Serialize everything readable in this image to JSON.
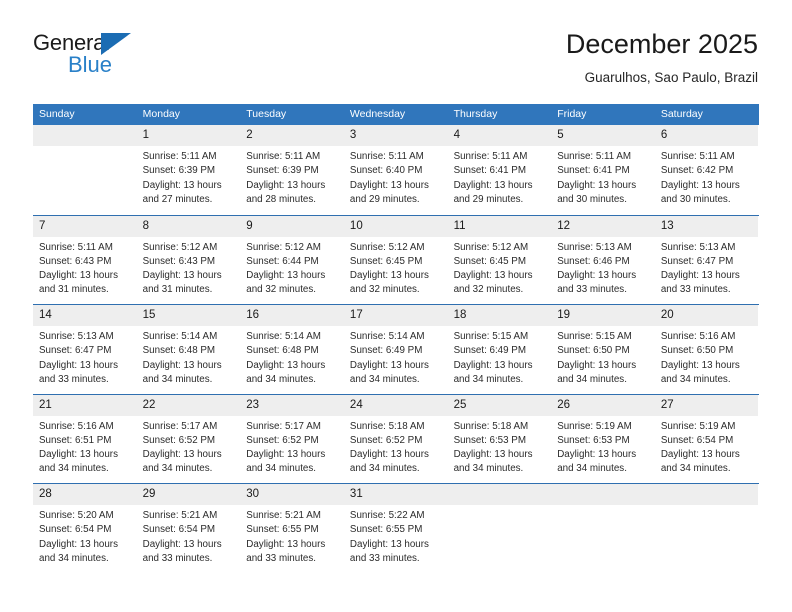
{
  "brand": {
    "name_part1": "General",
    "name_part2": "Blue",
    "color_dark": "#1b1b1b",
    "color_blue": "#2980c8",
    "triangle_color": "#1b6cb3"
  },
  "header": {
    "title": "December 2025",
    "subtitle": "Guarulhos, Sao Paulo, Brazil"
  },
  "theme": {
    "header_row_bg": "#3076bc",
    "header_row_text": "#ffffff",
    "week_separator": "#2f6fb0",
    "day_band_bg": "#eeeeee",
    "body_text": "#2b2b2b"
  },
  "calendar": {
    "weekdays": [
      "Sunday",
      "Monday",
      "Tuesday",
      "Wednesday",
      "Thursday",
      "Friday",
      "Saturday"
    ],
    "weeks": [
      [
        {
          "day": "",
          "lines": []
        },
        {
          "day": "1",
          "lines": [
            "Sunrise: 5:11 AM",
            "Sunset: 6:39 PM",
            "Daylight: 13 hours",
            "and 27 minutes."
          ]
        },
        {
          "day": "2",
          "lines": [
            "Sunrise: 5:11 AM",
            "Sunset: 6:39 PM",
            "Daylight: 13 hours",
            "and 28 minutes."
          ]
        },
        {
          "day": "3",
          "lines": [
            "Sunrise: 5:11 AM",
            "Sunset: 6:40 PM",
            "Daylight: 13 hours",
            "and 29 minutes."
          ]
        },
        {
          "day": "4",
          "lines": [
            "Sunrise: 5:11 AM",
            "Sunset: 6:41 PM",
            "Daylight: 13 hours",
            "and 29 minutes."
          ]
        },
        {
          "day": "5",
          "lines": [
            "Sunrise: 5:11 AM",
            "Sunset: 6:41 PM",
            "Daylight: 13 hours",
            "and 30 minutes."
          ]
        },
        {
          "day": "6",
          "lines": [
            "Sunrise: 5:11 AM",
            "Sunset: 6:42 PM",
            "Daylight: 13 hours",
            "and 30 minutes."
          ]
        }
      ],
      [
        {
          "day": "7",
          "lines": [
            "Sunrise: 5:11 AM",
            "Sunset: 6:43 PM",
            "Daylight: 13 hours",
            "and 31 minutes."
          ]
        },
        {
          "day": "8",
          "lines": [
            "Sunrise: 5:12 AM",
            "Sunset: 6:43 PM",
            "Daylight: 13 hours",
            "and 31 minutes."
          ]
        },
        {
          "day": "9",
          "lines": [
            "Sunrise: 5:12 AM",
            "Sunset: 6:44 PM",
            "Daylight: 13 hours",
            "and 32 minutes."
          ]
        },
        {
          "day": "10",
          "lines": [
            "Sunrise: 5:12 AM",
            "Sunset: 6:45 PM",
            "Daylight: 13 hours",
            "and 32 minutes."
          ]
        },
        {
          "day": "11",
          "lines": [
            "Sunrise: 5:12 AM",
            "Sunset: 6:45 PM",
            "Daylight: 13 hours",
            "and 32 minutes."
          ]
        },
        {
          "day": "12",
          "lines": [
            "Sunrise: 5:13 AM",
            "Sunset: 6:46 PM",
            "Daylight: 13 hours",
            "and 33 minutes."
          ]
        },
        {
          "day": "13",
          "lines": [
            "Sunrise: 5:13 AM",
            "Sunset: 6:47 PM",
            "Daylight: 13 hours",
            "and 33 minutes."
          ]
        }
      ],
      [
        {
          "day": "14",
          "lines": [
            "Sunrise: 5:13 AM",
            "Sunset: 6:47 PM",
            "Daylight: 13 hours",
            "and 33 minutes."
          ]
        },
        {
          "day": "15",
          "lines": [
            "Sunrise: 5:14 AM",
            "Sunset: 6:48 PM",
            "Daylight: 13 hours",
            "and 34 minutes."
          ]
        },
        {
          "day": "16",
          "lines": [
            "Sunrise: 5:14 AM",
            "Sunset: 6:48 PM",
            "Daylight: 13 hours",
            "and 34 minutes."
          ]
        },
        {
          "day": "17",
          "lines": [
            "Sunrise: 5:14 AM",
            "Sunset: 6:49 PM",
            "Daylight: 13 hours",
            "and 34 minutes."
          ]
        },
        {
          "day": "18",
          "lines": [
            "Sunrise: 5:15 AM",
            "Sunset: 6:49 PM",
            "Daylight: 13 hours",
            "and 34 minutes."
          ]
        },
        {
          "day": "19",
          "lines": [
            "Sunrise: 5:15 AM",
            "Sunset: 6:50 PM",
            "Daylight: 13 hours",
            "and 34 minutes."
          ]
        },
        {
          "day": "20",
          "lines": [
            "Sunrise: 5:16 AM",
            "Sunset: 6:50 PM",
            "Daylight: 13 hours",
            "and 34 minutes."
          ]
        }
      ],
      [
        {
          "day": "21",
          "lines": [
            "Sunrise: 5:16 AM",
            "Sunset: 6:51 PM",
            "Daylight: 13 hours",
            "and 34 minutes."
          ]
        },
        {
          "day": "22",
          "lines": [
            "Sunrise: 5:17 AM",
            "Sunset: 6:52 PM",
            "Daylight: 13 hours",
            "and 34 minutes."
          ]
        },
        {
          "day": "23",
          "lines": [
            "Sunrise: 5:17 AM",
            "Sunset: 6:52 PM",
            "Daylight: 13 hours",
            "and 34 minutes."
          ]
        },
        {
          "day": "24",
          "lines": [
            "Sunrise: 5:18 AM",
            "Sunset: 6:52 PM",
            "Daylight: 13 hours",
            "and 34 minutes."
          ]
        },
        {
          "day": "25",
          "lines": [
            "Sunrise: 5:18 AM",
            "Sunset: 6:53 PM",
            "Daylight: 13 hours",
            "and 34 minutes."
          ]
        },
        {
          "day": "26",
          "lines": [
            "Sunrise: 5:19 AM",
            "Sunset: 6:53 PM",
            "Daylight: 13 hours",
            "and 34 minutes."
          ]
        },
        {
          "day": "27",
          "lines": [
            "Sunrise: 5:19 AM",
            "Sunset: 6:54 PM",
            "Daylight: 13 hours",
            "and 34 minutes."
          ]
        }
      ],
      [
        {
          "day": "28",
          "lines": [
            "Sunrise: 5:20 AM",
            "Sunset: 6:54 PM",
            "Daylight: 13 hours",
            "and 34 minutes."
          ]
        },
        {
          "day": "29",
          "lines": [
            "Sunrise: 5:21 AM",
            "Sunset: 6:54 PM",
            "Daylight: 13 hours",
            "and 33 minutes."
          ]
        },
        {
          "day": "30",
          "lines": [
            "Sunrise: 5:21 AM",
            "Sunset: 6:55 PM",
            "Daylight: 13 hours",
            "and 33 minutes."
          ]
        },
        {
          "day": "31",
          "lines": [
            "Sunrise: 5:22 AM",
            "Sunset: 6:55 PM",
            "Daylight: 13 hours",
            "and 33 minutes."
          ]
        },
        {
          "day": "",
          "lines": []
        },
        {
          "day": "",
          "lines": []
        },
        {
          "day": "",
          "lines": []
        }
      ]
    ]
  }
}
